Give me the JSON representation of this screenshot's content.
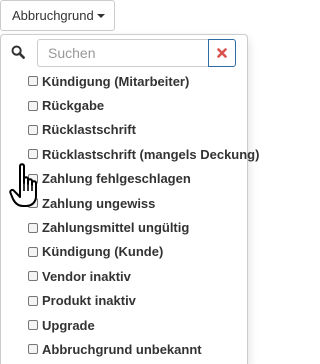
{
  "dropdown": {
    "button_label": "Abbruchgrund",
    "search_placeholder": "Suchen",
    "search_value": "",
    "search_icon": "search-icon",
    "clear_icon": "close-icon",
    "clear_icon_color": "#d9534f",
    "clear_border_color": "#2e6da4",
    "items": [
      {
        "label": "Kündigung (Mitarbeiter)",
        "checked": false
      },
      {
        "label": "Rückgabe",
        "checked": false
      },
      {
        "label": "Rücklastschrift",
        "checked": false
      },
      {
        "label": "Rücklastschrift (mangels Deckung)",
        "checked": false
      },
      {
        "label": "Zahlung fehlgeschlagen",
        "checked": false
      },
      {
        "label": "Zahlung ungewiss",
        "checked": false
      },
      {
        "label": "Zahlungsmittel ungültig",
        "checked": false
      },
      {
        "label": "Kündigung (Kunde)",
        "checked": false
      },
      {
        "label": "Vendor inaktiv",
        "checked": false
      },
      {
        "label": "Produkt inaktiv",
        "checked": false
      },
      {
        "label": "Upgrade",
        "checked": false
      },
      {
        "label": "Abbruchgrund unbekannt",
        "checked": false
      }
    ]
  },
  "cursor": {
    "type": "hand-pointer"
  }
}
